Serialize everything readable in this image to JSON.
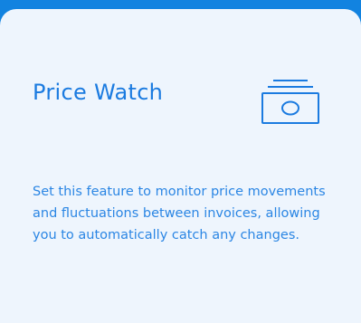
{
  "card": {
    "title": "Price Watch",
    "icon": "cash-icon",
    "description": "Set this feature to monitor price movements and fluctuations between invoices, allowing you to automatically catch any changes.",
    "colors": {
      "background": "#1283e0",
      "card": "#eef5fd",
      "accent": "#1b7be0"
    }
  }
}
